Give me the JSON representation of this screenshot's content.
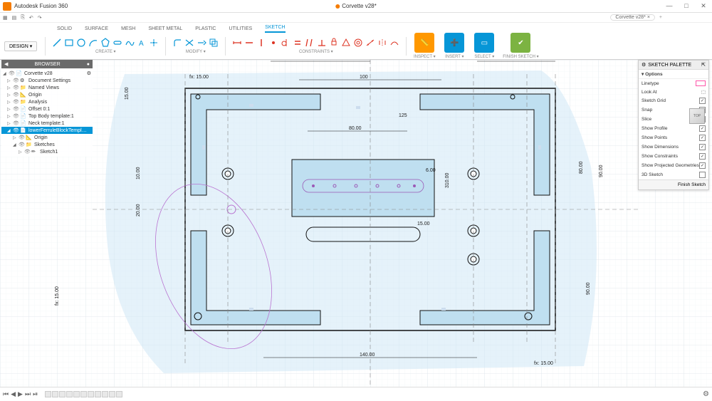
{
  "app": {
    "name": "Autodesk Fusion 360",
    "document": "Corvette v28*"
  },
  "window": {
    "min": "—",
    "max": "□",
    "close": "✕"
  },
  "qat": {
    "items": [
      "▦",
      "▤",
      "⎘",
      "↶",
      "↷"
    ],
    "tab_label": "Corvette v28*",
    "add": "+"
  },
  "ribbon_tabs": [
    "SOLID",
    "SURFACE",
    "MESH",
    "SHEET METAL",
    "PLASTIC",
    "UTILITIES",
    "SKETCH"
  ],
  "ribbon_active": 6,
  "design_button": "DESIGN ▾",
  "ribbon_groups": {
    "create": "CREATE ▾",
    "modify": "MODIFY ▾",
    "constraints": "CONSTRAINTS ▾",
    "inspect": "INSPECT ▾",
    "insert": "INSERT ▾",
    "select": "SELECT ▾",
    "finish": "FINISH SKETCH ▾"
  },
  "browser": {
    "title": "BROWSER",
    "nodes": [
      {
        "depth": 0,
        "expanded": true,
        "eye": true,
        "icon": "📄",
        "label": "Corvette v28",
        "gear": true
      },
      {
        "depth": 1,
        "expanded": false,
        "eye": true,
        "icon": "⚙",
        "label": "Document Settings"
      },
      {
        "depth": 1,
        "expanded": false,
        "eye": true,
        "icon": "📁",
        "label": "Named Views"
      },
      {
        "depth": 1,
        "expanded": false,
        "eye": true,
        "icon": "📐",
        "label": "Origin"
      },
      {
        "depth": 1,
        "expanded": false,
        "eye": true,
        "icon": "📁",
        "label": "Analysis"
      },
      {
        "depth": 1,
        "expanded": false,
        "eye": true,
        "icon": "📄",
        "label": "Offset 0:1"
      },
      {
        "depth": 1,
        "expanded": false,
        "eye": true,
        "icon": "📄",
        "label": "Top Body template:1"
      },
      {
        "depth": 1,
        "expanded": false,
        "eye": true,
        "icon": "📄",
        "label": "Neck template:1"
      },
      {
        "depth": 1,
        "expanded": true,
        "eye": true,
        "icon": "📄",
        "label": "lowerFerruleBlockTempl…",
        "selected": true
      },
      {
        "depth": 2,
        "expanded": false,
        "eye": true,
        "icon": "📐",
        "label": "Origin"
      },
      {
        "depth": 2,
        "expanded": true,
        "eye": true,
        "icon": "📁",
        "label": "Sketches"
      },
      {
        "depth": 3,
        "expanded": false,
        "eye": true,
        "icon": "✏",
        "label": "Sketch1"
      }
    ]
  },
  "palette": {
    "title": "SKETCH PALETTE",
    "section": "Options",
    "options": [
      {
        "label": "Linetype",
        "type": "linetype"
      },
      {
        "label": "Look At",
        "type": "icon",
        "glyph": "⬚"
      },
      {
        "label": "Sketch Grid",
        "type": "check",
        "checked": true
      },
      {
        "label": "Snap",
        "type": "check",
        "checked": true
      },
      {
        "label": "Slice",
        "type": "check",
        "checked": false
      },
      {
        "label": "Show Profile",
        "type": "check",
        "checked": true
      },
      {
        "label": "Show Points",
        "type": "check",
        "checked": true
      },
      {
        "label": "Show Dimensions",
        "type": "check",
        "checked": true
      },
      {
        "label": "Show Constraints",
        "type": "check",
        "checked": true
      },
      {
        "label": "Show Projected Geometries",
        "type": "check",
        "checked": true
      },
      {
        "label": "3D Sketch",
        "type": "check",
        "checked": false
      }
    ],
    "finish": "Finish Sketch"
  },
  "viewcube": {
    "face": "TOP"
  },
  "timeline": {
    "controls": [
      "⏮",
      "◀",
      "▶",
      "⏭",
      "⏯"
    ],
    "step_count": 11
  },
  "dimensions": {
    "d_80_top": "80.00",
    "d_100": "100",
    "d_80_top_right": "80.00",
    "d_fx15_tl": "fx: 15.00",
    "d_15_left": "15.00",
    "d_80_inner": "80.00",
    "d_125": "125",
    "d_600": "6.00",
    "d_310": "310.00",
    "d_80_side": "80.00",
    "d_90_side": "90.00",
    "d_10": "10.00",
    "d_20": "20.00",
    "d_1500": "15.00",
    "d_90_r": "90.00",
    "d_fx15_bl": "fx: 15.00",
    "d_140": "140.00",
    "d_fx15_br": "fx: 15.00"
  }
}
